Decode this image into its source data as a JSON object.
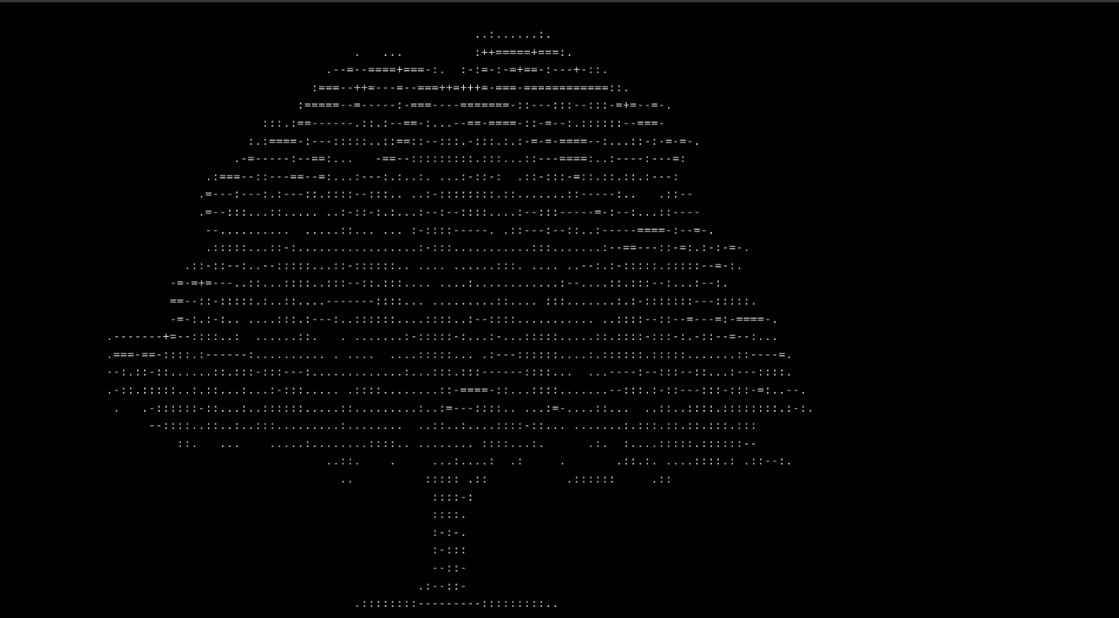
{
  "colors": {
    "background": "#000000",
    "foreground": "#cccccc",
    "title_bar": "#3a3a3a"
  },
  "terminal": {
    "lines": [
      "                                                                   ..:......:.",
      "                                                  .   ...          :++=====+===:.",
      "                                              .--=--====+===-:.  :-:=-:-=+==-:---+-::.",
      "                                            :===--++=---=--===++=+++=-===-============::.",
      "                                          :=====--=-----:-===----=======-::---:::--:::-=+=--=-.",
      "                                     :::.:==------.::.:--==-:...--==-====-::-=--:.::::::--===-",
      "                                   :.:====-:---:::::..::==::--:::.-:::.:.:-=-=-====--:...::-:-=-=-.",
      "                                 .-=-----:--==:...   -==--:::::::::.:::...::---====:..:----:---=:",
      "                             .:===--::---==--=:...:---:.:..:. ...:-::-:  .::-:::-=::.::.::.:---:",
      "                            .=---:---:.:---::.::::--:::.. ..:-::::::::.::.......::-----:..   .::--",
      "                            .=--:::...::..... ..:-::-:.:...:--:--::::....:--:::-----=-:--:...::----",
      "                             --..........  .....::... ... :-::::-----. .::---:--::..:-----====-:--=-.",
      "                             .:::::...::-:.................:-:::...........:::.......:--==---::-=:.:-:-=-.",
      "                          .::-::--:..--:::::...::-::::::.. .... ......:::. .... ..--:.:-:::::.:::::--=-:.",
      "                        -=-=+=---..::...::::..:::--::.:::.... ....:............:--....::.:::--:...:--:.",
      "                        ==--::-:::::.:..::....-------::::... .........::.... :::.......:.:-:::::::---:::::.",
      "                        -=-:.:-:.. ....:::.:---:..::::::....::::..:--::::........... ..::::--::--=---=:-====-.",
      "               .-------+=--::::..:  ......::.   . .......:-:::::-:...:-...:::::.....::.::::-:::-:.-::--=--:...",
      "               .===-==-::::.:------:.......... . ....  ....:::::... .:---::::::....:.::::::.:::::.......::----=.",
      "               --:.::-::......::.:::-:::---:.............:...:::.:::------::::...  ...----:--:::--::...:---::::.",
      "               .-::.:::::..:.::...:...:-:::..... .::::........::-====-::...::::.......--:::.:-::---:::-:::-=:..--.",
      "                .   .-::::::-::...:..::::::.....::.........:..:=---::::.. ...:=-....::...  ..::..::::.::::::::.:-:.",
      "                     --::::..::..:..:::.........:........  ..::..:....::::-::... .......:.:::.::.::.:::.:::",
      "                         ::.   ...    .....:........::::.. ........ ::::...:.      .:.  :....:::::.::::::--",
      "                                              ..::.    .     ...:....:  .:     .       .::.:. ....::::.: .::--:.",
      "                                                ..          ::::: .::           .::::::     .::",
      "                                                             ::::-:",
      "                                                             ::::.",
      "                                                             :-:-.",
      "                                                             :-:::",
      "                                                             --::-",
      "                                                           .:--::-",
      "                                                  .::::::::---------:::::::::.."
    ]
  }
}
